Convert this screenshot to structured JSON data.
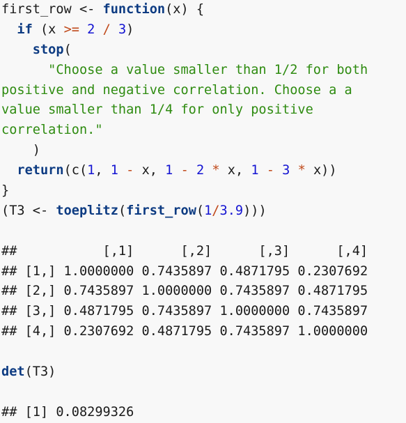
{
  "theme": {
    "background": "#f8f8f8",
    "foreground": "#1a1a1a",
    "keyword_color": "#0d3b82",
    "number_color": "#1414d2",
    "operator_color": "#c0491a",
    "string_color": "#2e8b10",
    "output_color": "#1a1a1a"
  },
  "code": {
    "language": "r",
    "lines": [
      {
        "id": "line-1",
        "tokens": [
          {
            "t": "first_row ",
            "c": "plain"
          },
          {
            "t": "<- ",
            "c": "plain"
          },
          {
            "t": "function",
            "c": "kw"
          },
          {
            "t": "(x) {",
            "c": "plain"
          }
        ]
      },
      {
        "id": "line-2",
        "tokens": [
          {
            "t": "  ",
            "c": "plain"
          },
          {
            "t": "if",
            "c": "kw"
          },
          {
            "t": " (x ",
            "c": "plain"
          },
          {
            "t": ">=",
            "c": "op"
          },
          {
            "t": " ",
            "c": "plain"
          },
          {
            "t": "2",
            "c": "num"
          },
          {
            "t": " ",
            "c": "plain"
          },
          {
            "t": "/",
            "c": "op"
          },
          {
            "t": " ",
            "c": "plain"
          },
          {
            "t": "3",
            "c": "num"
          },
          {
            "t": ")",
            "c": "plain"
          }
        ]
      },
      {
        "id": "line-3",
        "tokens": [
          {
            "t": "    ",
            "c": "plain"
          },
          {
            "t": "stop",
            "c": "kw"
          },
          {
            "t": "(",
            "c": "plain"
          }
        ]
      },
      {
        "id": "line-4",
        "tokens": [
          {
            "t": "      ",
            "c": "plain"
          },
          {
            "t": "\"Choose a value smaller than 1/2 for both",
            "c": "str"
          }
        ]
      },
      {
        "id": "line-5",
        "tokens": [
          {
            "t": "positive and negative correlation. Choose a a",
            "c": "str"
          }
        ]
      },
      {
        "id": "line-6",
        "tokens": [
          {
            "t": "value smaller than 1/4 for only positive",
            "c": "str"
          }
        ]
      },
      {
        "id": "line-7",
        "tokens": [
          {
            "t": "correlation.\"",
            "c": "str"
          }
        ]
      },
      {
        "id": "line-8",
        "tokens": [
          {
            "t": "    )",
            "c": "plain"
          }
        ]
      },
      {
        "id": "line-9",
        "tokens": [
          {
            "t": "  ",
            "c": "plain"
          },
          {
            "t": "return",
            "c": "kw"
          },
          {
            "t": "(",
            "c": "plain"
          },
          {
            "t": "c",
            "c": "plain"
          },
          {
            "t": "(",
            "c": "plain"
          },
          {
            "t": "1",
            "c": "num"
          },
          {
            "t": ", ",
            "c": "plain"
          },
          {
            "t": "1",
            "c": "num"
          },
          {
            "t": " ",
            "c": "plain"
          },
          {
            "t": "-",
            "c": "op"
          },
          {
            "t": " x, ",
            "c": "plain"
          },
          {
            "t": "1",
            "c": "num"
          },
          {
            "t": " ",
            "c": "plain"
          },
          {
            "t": "-",
            "c": "op"
          },
          {
            "t": " ",
            "c": "plain"
          },
          {
            "t": "2",
            "c": "num"
          },
          {
            "t": " ",
            "c": "plain"
          },
          {
            "t": "*",
            "c": "op"
          },
          {
            "t": " x, ",
            "c": "plain"
          },
          {
            "t": "1",
            "c": "num"
          },
          {
            "t": " ",
            "c": "plain"
          },
          {
            "t": "-",
            "c": "op"
          },
          {
            "t": " ",
            "c": "plain"
          },
          {
            "t": "3",
            "c": "num"
          },
          {
            "t": " ",
            "c": "plain"
          },
          {
            "t": "*",
            "c": "op"
          },
          {
            "t": " x))",
            "c": "plain"
          }
        ]
      },
      {
        "id": "line-10",
        "tokens": [
          {
            "t": "}",
            "c": "plain"
          }
        ]
      },
      {
        "id": "line-11",
        "tokens": [
          {
            "t": "(T3 <- ",
            "c": "plain"
          },
          {
            "t": "toeplitz",
            "c": "kw"
          },
          {
            "t": "(",
            "c": "plain"
          },
          {
            "t": "first_row",
            "c": "kw"
          },
          {
            "t": "(",
            "c": "plain"
          },
          {
            "t": "1",
            "c": "num"
          },
          {
            "t": "/",
            "c": "op"
          },
          {
            "t": "3.9",
            "c": "num"
          },
          {
            "t": ")))",
            "c": "plain"
          }
        ]
      }
    ]
  },
  "output_matrix": {
    "lines": [
      "##           [,1]      [,2]      [,3]      [,4]",
      "## [1,] 1.0000000 0.7435897 0.4871795 0.2307692",
      "## [2,] 0.7435897 1.0000000 0.7435897 0.4871795",
      "## [3,] 0.4871795 0.7435897 1.0000000 0.7435897",
      "## [4,] 0.2307692 0.4871795 0.7435897 1.0000000"
    ],
    "column_headers": [
      "[,1]",
      "[,2]",
      "[,3]",
      "[,4]"
    ],
    "row_labels": [
      "[1,]",
      "[2,]",
      "[3,]",
      "[4,]"
    ],
    "values": [
      [
        "1.0000000",
        "0.7435897",
        "0.4871795",
        "0.2307692"
      ],
      [
        "0.7435897",
        "1.0000000",
        "0.7435897",
        "0.4871795"
      ],
      [
        "0.4871795",
        "0.7435897",
        "1.0000000",
        "0.7435897"
      ],
      [
        "0.2307692",
        "0.4871795",
        "0.7435897",
        "1.0000000"
      ]
    ]
  },
  "code2": {
    "lines": [
      {
        "id": "line-det",
        "tokens": [
          {
            "t": "det",
            "c": "kw"
          },
          {
            "t": "(T3)",
            "c": "plain"
          }
        ]
      }
    ]
  },
  "output_det": {
    "lines": [
      "## [1] 0.08299326"
    ],
    "value": "0.08299326"
  }
}
